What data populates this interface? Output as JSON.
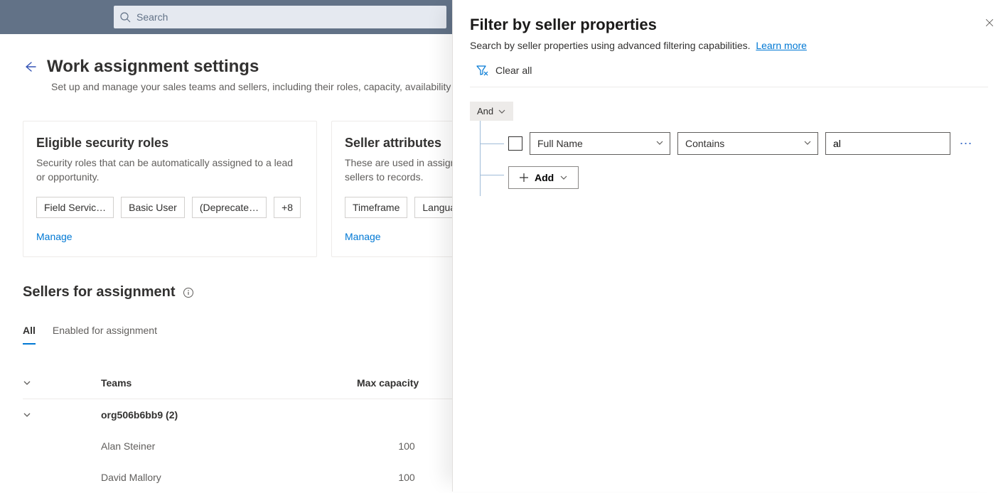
{
  "search": {
    "placeholder": "Search"
  },
  "page": {
    "title": "Work assignment settings",
    "subtitle": "Set up and manage your sales teams and sellers, including their roles, capacity, availability and attributes, so that they're available for assignment."
  },
  "cards": {
    "roles": {
      "title": "Eligible security roles",
      "desc": "Security roles that can be automatically assigned to a lead or opportunity.",
      "chips": [
        "Field Servic…",
        "Basic User",
        "(Deprecate…",
        "+8"
      ],
      "manage": "Manage"
    },
    "attributes": {
      "title": "Seller attributes",
      "desc": "These are used in assignment rules to match sellers to records.",
      "chips": [
        "Timeframe",
        "Language"
      ],
      "manage": "Manage"
    }
  },
  "sellers": {
    "sectionTitle": "Sellers for assignment",
    "pivots": {
      "all": "All",
      "enabled": "Enabled for assignment"
    },
    "columns": {
      "teams": "Teams",
      "capacity": "Max capacity"
    },
    "group": "org506b6bb9 (2)",
    "rows": [
      {
        "name": "Alan Steiner",
        "capacity": "100"
      },
      {
        "name": "David Mallory",
        "capacity": "100"
      }
    ]
  },
  "panel": {
    "title": "Filter by seller properties",
    "subtitle": "Search by seller properties using advanced filtering capabilities.",
    "learnMore": "Learn more",
    "clearAll": "Clear all",
    "and": "And",
    "condition": {
      "field": "Full Name",
      "operator": "Contains",
      "value": "al"
    },
    "add": "Add"
  }
}
